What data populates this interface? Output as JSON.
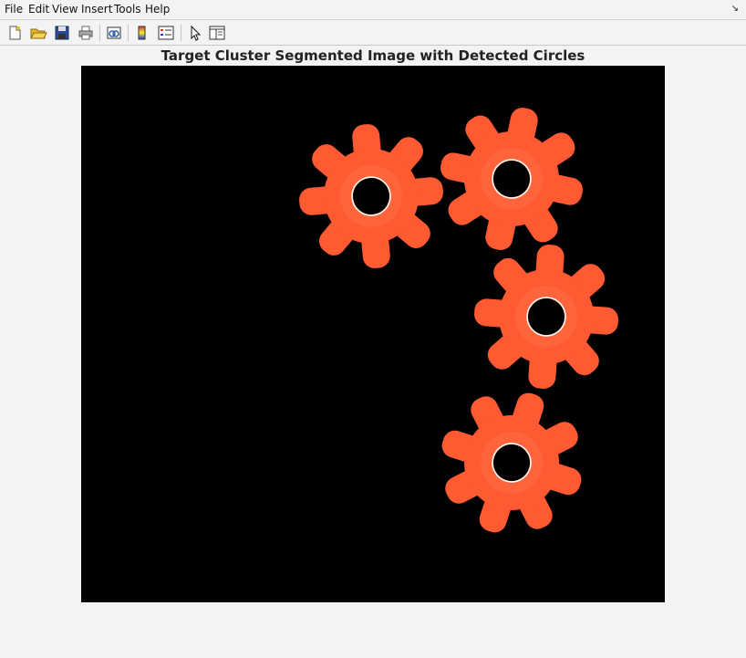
{
  "menu": {
    "file": "File",
    "edit": "Edit",
    "view": "View",
    "insert": "Insert",
    "tools": "Tools",
    "help": "Help"
  },
  "toolbar": {
    "icons": [
      "new-figure-icon",
      "open-file-icon",
      "save-icon",
      "print-icon",
      "link-plot-icon",
      "colorbar-icon",
      "legend-icon",
      "edit-plot-pointer-icon",
      "property-editor-icon"
    ]
  },
  "figure": {
    "title": "Target Cluster Segmented Image with Detected Circles",
    "background_color": "#000000",
    "gear_color": "#ff5a32",
    "gear_highlight": "#ff6d44",
    "circle_outline_color": "#ffffff",
    "gear_count": 4
  }
}
